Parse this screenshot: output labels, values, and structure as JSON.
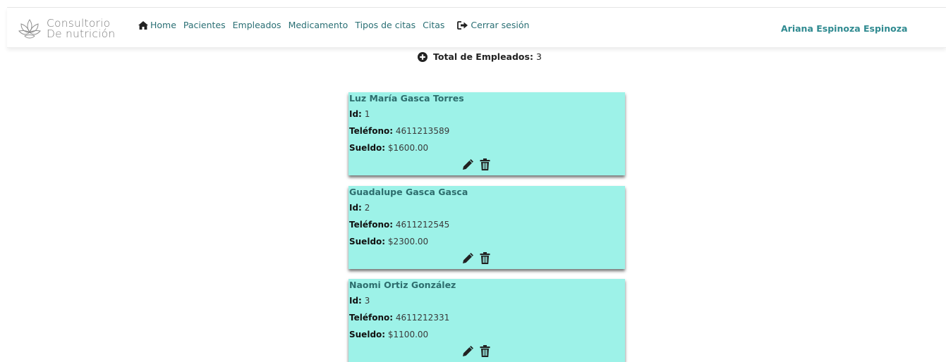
{
  "brand": {
    "line1": "Consultorio",
    "line2": "De nutrición",
    "icon": "lotus-icon"
  },
  "nav": {
    "items": [
      {
        "label": "Home",
        "icon": "home-icon"
      },
      {
        "label": "Pacientes"
      },
      {
        "label": "Empleados"
      },
      {
        "label": "Medicamento"
      },
      {
        "label": "Tipos de citas"
      },
      {
        "label": "Citas"
      },
      {
        "label": "Cerrar sesión",
        "icon": "sign-out-icon"
      }
    ],
    "user_name": "Ariana Espinoza Espinoza"
  },
  "summary": {
    "label": "Total de Empleados:",
    "count": "3",
    "icon": "plus-circle-icon"
  },
  "field_labels": {
    "id": "Id:",
    "telefono": "Teléfono:",
    "sueldo": "Sueldo:"
  },
  "employees": [
    {
      "name": "Luz María Gasca Torres",
      "id": "1",
      "telefono": "4611213589",
      "sueldo": "$1600.00"
    },
    {
      "name": "Guadalupe Gasca Gasca",
      "id": "2",
      "telefono": "4611212545",
      "sueldo": "$2300.00"
    },
    {
      "name": "Naomi Ortiz González",
      "id": "3",
      "telefono": "4611212331",
      "sueldo": "$1100.00"
    }
  ],
  "colors": {
    "card_bg": "#9df2e8",
    "accent": "#2f8a90",
    "nav_text": "#2a6f74"
  }
}
